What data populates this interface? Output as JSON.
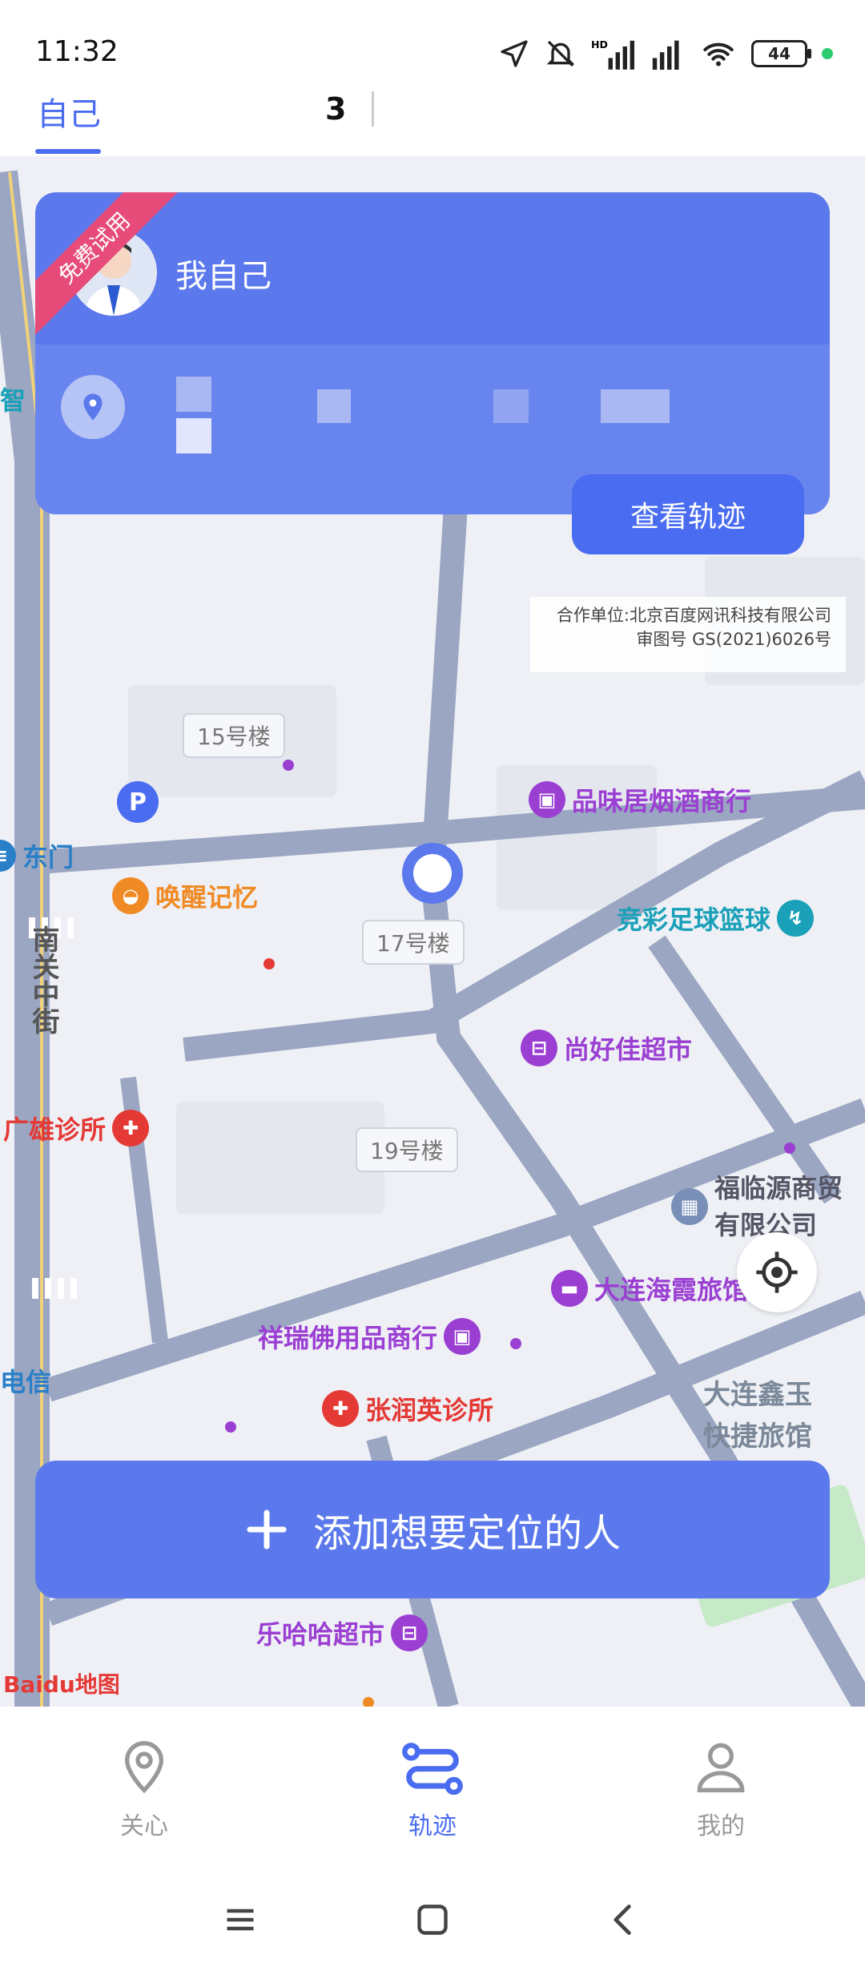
{
  "status_bar": {
    "time": "11:32",
    "battery": "44",
    "signal_label": "HD"
  },
  "tabs": {
    "self": "自己",
    "count": "3"
  },
  "card": {
    "badge": "免费试用",
    "name": "我自己",
    "track_button": "查看轨迹"
  },
  "map": {
    "credit_line1": "合作单位:北京百度网讯科技有限公司",
    "credit_line2": "审图号 GS(2021)6026号",
    "buildings": [
      "15号楼",
      "17号楼",
      "19号楼"
    ],
    "pois": {
      "pinwei": "品味居烟酒商行",
      "huanxing": "唤醒记忆",
      "jingcai": "竞彩足球篮球",
      "shanghaojia": "尚好佳超市",
      "guangxiong": "广雄诊所",
      "fulinyuan_1": "福临源商贸",
      "fulinyuan_2": "有限公司",
      "dalian_haixia": "大连海霞旅馆",
      "xiangrui": "祥瑞佛用品商行",
      "zhangrunying": "张润英诊所",
      "dalian_xinyu_1": "大连鑫玉",
      "dalian_xinyu_2": "快捷旅馆",
      "dongmen": "东门",
      "street": "南关中街",
      "dianxin": "电信",
      "lehaha": "乐哈哈超市",
      "zhi": "智"
    },
    "baidu_logo": "Baidu地图"
  },
  "add_button": {
    "label": "添加想要定位的人"
  },
  "bottom_nav": [
    {
      "label": "关心"
    },
    {
      "label": "轨迹"
    },
    {
      "label": "我的"
    }
  ]
}
